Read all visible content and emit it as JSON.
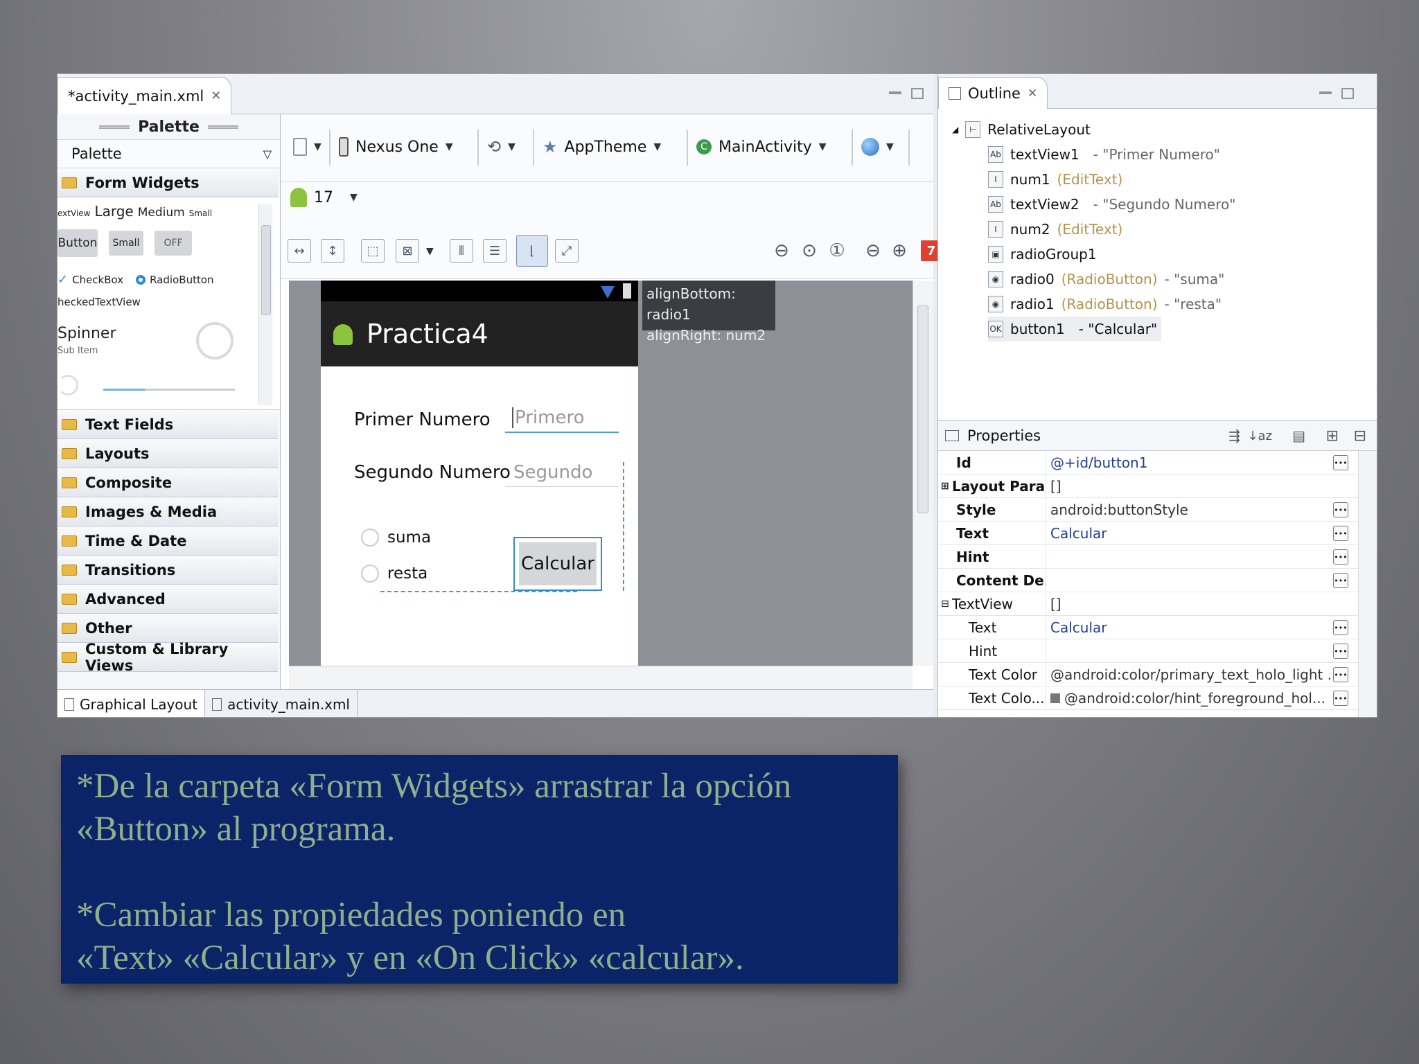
{
  "editor": {
    "tab_title": "*activity_main.xml",
    "palette_title": "Palette",
    "palette_dropdown": "Palette",
    "form_widgets": {
      "label": "Form Widgets",
      "text_sizes": [
        "extView",
        "Large",
        "Medium",
        "Small"
      ],
      "buttons": [
        "Button",
        "Small",
        "OFF"
      ],
      "checkbox": "CheckBox",
      "radiobutton": "RadioButton",
      "checkedtext": "heckedTextView",
      "spinner": "Spinner",
      "spinner_sub": "Sub Item"
    },
    "categories": [
      "Text Fields",
      "Layouts",
      "Composite",
      "Images & Media",
      "Time & Date",
      "Transitions",
      "Advanced",
      "Other",
      "Custom & Library Views"
    ],
    "toolbar": {
      "device": "Nexus One",
      "theme": "AppTheme",
      "activity": "MainActivity",
      "api": "17"
    },
    "error_badge": "7",
    "tooltip": [
      "alignBottom: radio1",
      "alignRight: num2"
    ],
    "phone": {
      "app_title": "Practica4",
      "label1": "Primer Numero",
      "hint1": "Primero",
      "label2": "Segundo Numero",
      "hint2": "Segundo",
      "radio0": "suma",
      "radio1": "resta",
      "button": "Calcular"
    },
    "bottom_tabs": [
      "Graphical Layout",
      "activity_main.xml"
    ]
  },
  "outline": {
    "tab_title": "Outline",
    "root": "RelativeLayout",
    "nodes": [
      {
        "id": "textView1",
        "type": "",
        "text": " - \"Primer Numero\""
      },
      {
        "id": "num1",
        "type": " (EditText)",
        "text": ""
      },
      {
        "id": "textView2",
        "type": "",
        "text": " - \"Segundo Numero\""
      },
      {
        "id": "num2",
        "type": " (EditText)",
        "text": ""
      },
      {
        "id": "radioGroup1",
        "type": "",
        "text": ""
      },
      {
        "id": "radio0",
        "type": " (RadioButton)",
        "text": " - \"suma\""
      },
      {
        "id": "radio1",
        "type": " (RadioButton)",
        "text": " - \"resta\""
      },
      {
        "id": "button1",
        "type": "",
        "text": " - \"Calcular\""
      }
    ]
  },
  "properties": {
    "title": "Properties",
    "rows": [
      {
        "key": "Id",
        "value": "@+id/button1"
      },
      {
        "key": "Layout Para...",
        "value": "[]"
      },
      {
        "key": "Style",
        "value": "android:buttonStyle"
      },
      {
        "key": "Text",
        "value": "Calcular"
      },
      {
        "key": "Hint",
        "value": ""
      },
      {
        "key": "Content De...",
        "value": ""
      },
      {
        "key": "TextView",
        "value": "[]"
      },
      {
        "key": "Text",
        "value": "Calcular"
      },
      {
        "key": "Hint",
        "value": ""
      },
      {
        "key": "Text Color",
        "value": "@android:color/primary_text_holo_light ..."
      },
      {
        "key": "Text Colo...",
        "value": "@android:color/hint_foreground_hol..."
      }
    ]
  },
  "caption": {
    "line1": "*De la carpeta «Form Widgets» arrastrar la opción",
    "line2": "«Button» al programa.",
    "line3": "*Cambiar las propiedades poniendo en",
    "line4": "«Text» «Calcular» y en «On Click» «calcular»."
  },
  "colors": {
    "caption_bg": "#0b2468",
    "caption_text": "#8fae8c",
    "selection": "#2e8bd6"
  }
}
